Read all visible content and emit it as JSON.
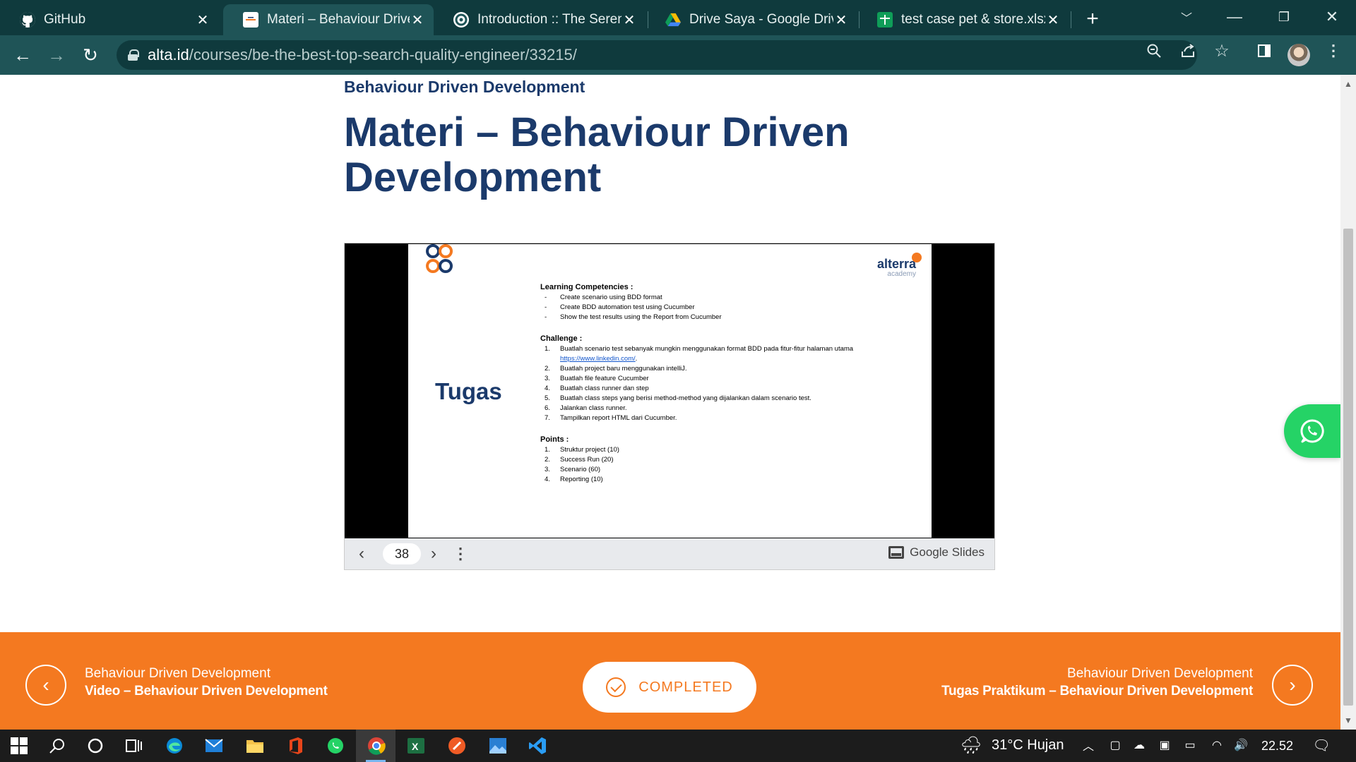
{
  "browser": {
    "tabs": [
      {
        "title": "GitHub",
        "active": false,
        "icon": "github-icon"
      },
      {
        "title": "Materi – Behaviour Driven Development",
        "active": true,
        "icon": "alterra-icon"
      },
      {
        "title": "Introduction :: The Serenity BDD",
        "active": false,
        "icon": "serenity-icon"
      },
      {
        "title": "Drive Saya - Google Drive",
        "active": false,
        "icon": "google-drive-icon"
      },
      {
        "title": "test case pet & store.xlsx",
        "active": false,
        "icon": "google-sheets-icon"
      }
    ],
    "url_host": "alta.id",
    "url_path": "/courses/be-the-best-top-search-quality-engineer/33215/"
  },
  "page": {
    "section_title": "Behaviour Driven Development",
    "title": "Materi – Behaviour Driven Development"
  },
  "slide": {
    "brand_name": "alterra",
    "brand_sub": "academy",
    "heading": "Tugas",
    "competencies_title": "Learning Competencies :",
    "competencies": [
      "Create scenario using BDD format",
      "Create BDD automation test using Cucumber",
      "Show the test results using the Report from Cucumber"
    ],
    "challenge_title": "Challenge :",
    "challenge_1_text": "Buatlah scenario test sebanyak mungkin menggunakan format BDD pada fitur-fitur halaman utama",
    "challenge_1_link": "https://www.linkedin.com/",
    "challenge": [
      "Buatlah project baru menggunakan intelliJ.",
      "Buatlah file feature Cucumber",
      "Buatlah class runner dan step",
      "Buatlah class steps yang berisi method-method yang dijalankan dalam scenario test.",
      "Jalankan class runner.",
      "Tampilkan report HTML dari Cucumber."
    ],
    "points_title": "Points :",
    "points": [
      "Struktur project (10)",
      "Success Run (20)",
      "Scenario (60)",
      "Reporting (10)"
    ]
  },
  "slides_bar": {
    "page_number": "38",
    "brand_label": "Google Slides"
  },
  "footer_nav": {
    "prev_section": "Behaviour Driven Development",
    "prev_title": "Video – Behaviour Driven Development",
    "completed_label": "COMPLETED",
    "next_section": "Behaviour Driven Development",
    "next_title": "Tugas Praktikum – Behaviour Driven Development"
  },
  "taskbar": {
    "weather": "31°C  Hujan",
    "time": "22.52"
  },
  "colors": {
    "brand_navy": "#1b3a6b",
    "brand_orange": "#f47920",
    "whatsapp_green": "#25d366",
    "chrome_tabbar": "#0f3a3d",
    "chrome_toolbar": "#1f5457"
  }
}
